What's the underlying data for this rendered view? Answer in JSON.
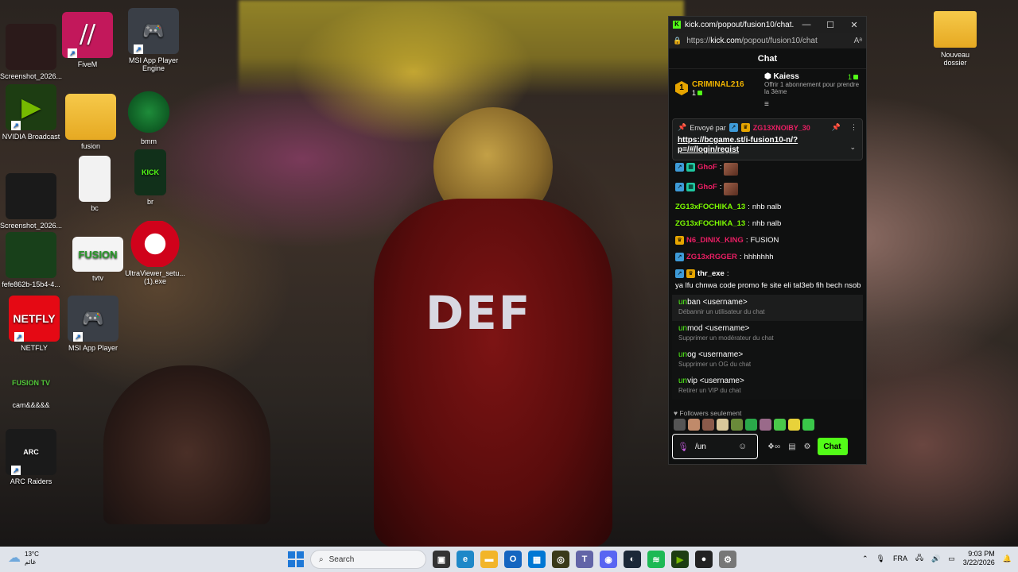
{
  "desktop": {
    "icons": [
      {
        "label": "Screenshot_2026..."
      },
      {
        "label": "FiveM"
      },
      {
        "label": "MSI App Player Engine"
      },
      {
        "label": "NVIDIA Broadcast"
      },
      {
        "label": "fusion"
      },
      {
        "label": "bmm"
      },
      {
        "label": "Screenshot_2026..."
      },
      {
        "label": "bc"
      },
      {
        "label": "br"
      },
      {
        "label": "fefe862b-15b4-4..."
      },
      {
        "label": "tvtv"
      },
      {
        "label": "UltraViewer_setu... (1).exe"
      },
      {
        "label": "NETFLY"
      },
      {
        "label": "MSI App Player"
      },
      {
        "label": "cam&&&&&"
      },
      {
        "label": "ARC Raiders"
      }
    ],
    "folder_right": "Nouveau dossier",
    "wallpaper_shirt_text": "DEF"
  },
  "window": {
    "title": "kick.com/popout/fusion10/chat...",
    "url_prefix": "https://",
    "url_host": "kick.com",
    "url_path": "/popout/fusion10/chat",
    "minimize": "—",
    "maximize": "☐",
    "close": "✕"
  },
  "chat": {
    "header": "Chat",
    "leaderboard": {
      "rank": "1",
      "top_user": "CRIMINAL216",
      "top_count": "1",
      "gifter": "Kaiess",
      "gifter_desc": "Offrir 1 abonnement pour prendre la 3ème",
      "gifter_count": "1"
    },
    "pinned": {
      "prefix": "Envoyé par",
      "sender": "ZG13XNOIBY_30",
      "link": "https://bcgame.st/i-fusion10-n/?p=/#/login/regist"
    },
    "messages": [
      {
        "user": "GhoF",
        "color": "#e91e63",
        "text": "",
        "emote": true
      },
      {
        "user": "GhoF",
        "color": "#e91e63",
        "text": "",
        "emote": true
      },
      {
        "user": "ZG13xFOCHIKA_13",
        "color": "#7CFC00",
        "text": "nhb nalb",
        "emote": false
      },
      {
        "user": "ZG13xFOCHIKA_13",
        "color": "#7CFC00",
        "text": "nhb nalb",
        "emote": false
      },
      {
        "user": "N6_DINIX_KING",
        "color": "#e91e63",
        "text": "FUSION",
        "emote": false
      },
      {
        "user": "ZG13xRGGER",
        "color": "#e91e63",
        "text": "hhhhhhh",
        "emote": false
      },
      {
        "user": "thr_exe",
        "color": "#ffffff",
        "text": "ya lfu chnwa code promo fe site eli tal3eb fih bech nsob",
        "emote": false
      }
    ],
    "suggestions": [
      {
        "match": "un",
        "rest": "ban <username>",
        "desc": "Débannir un utilisateur du chat"
      },
      {
        "match": "un",
        "rest": "mod <username>",
        "desc": "Supprimer un modérateur du chat"
      },
      {
        "match": "un",
        "rest": "og <username>",
        "desc": "Supprimer un OG du chat"
      },
      {
        "match": "un",
        "rest": "vip <username>",
        "desc": "Retirer un VIP du chat"
      }
    ],
    "followers_only": "Followers seulement",
    "input_value": "/un",
    "send_label": "Chat"
  },
  "taskbar": {
    "weather_temp": "13°C",
    "weather_desc": "غائم",
    "search_placeholder": "Search",
    "lang": "FRA",
    "time": "9:03 PM",
    "date": "3/22/2026"
  },
  "colors": {
    "kick_green": "#53fc18",
    "pinned_sender": "#e91e63",
    "leaderboard_gold": "#f0b400"
  }
}
